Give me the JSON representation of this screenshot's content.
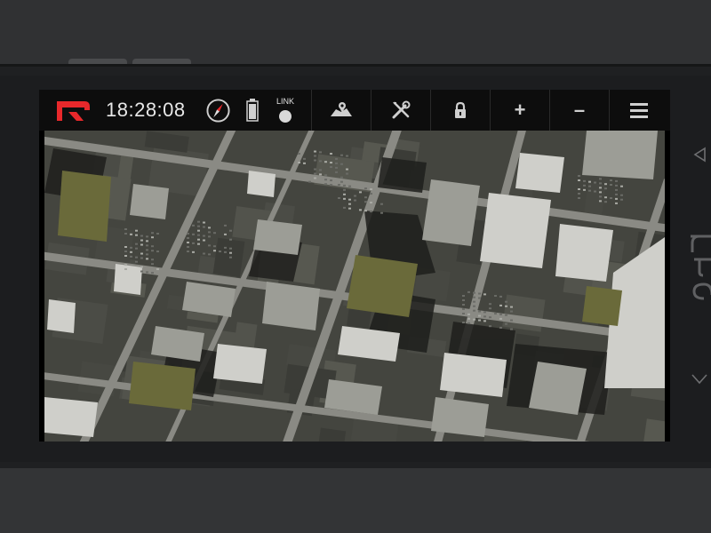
{
  "app": {
    "clock": "18:28:08",
    "link_label": "LINK",
    "logo_color": "#e8282b"
  },
  "toolbar": {
    "buttons": [
      {
        "name": "map-layers-button",
        "icon": "map-icon"
      },
      {
        "name": "tools-button",
        "icon": "wrench-screwdriver-icon"
      },
      {
        "name": "lock-button",
        "icon": "lock-icon"
      },
      {
        "name": "zoom-in-button",
        "icon": "plus-icon",
        "glyph": "+"
      },
      {
        "name": "zoom-out-button",
        "icon": "minus-icon",
        "glyph": "–"
      },
      {
        "name": "menu-button",
        "icon": "hamburger-menu-icon"
      }
    ]
  },
  "map": {
    "type": "aerial-satellite-imagery"
  },
  "device": {
    "brand_logo": "htc"
  }
}
